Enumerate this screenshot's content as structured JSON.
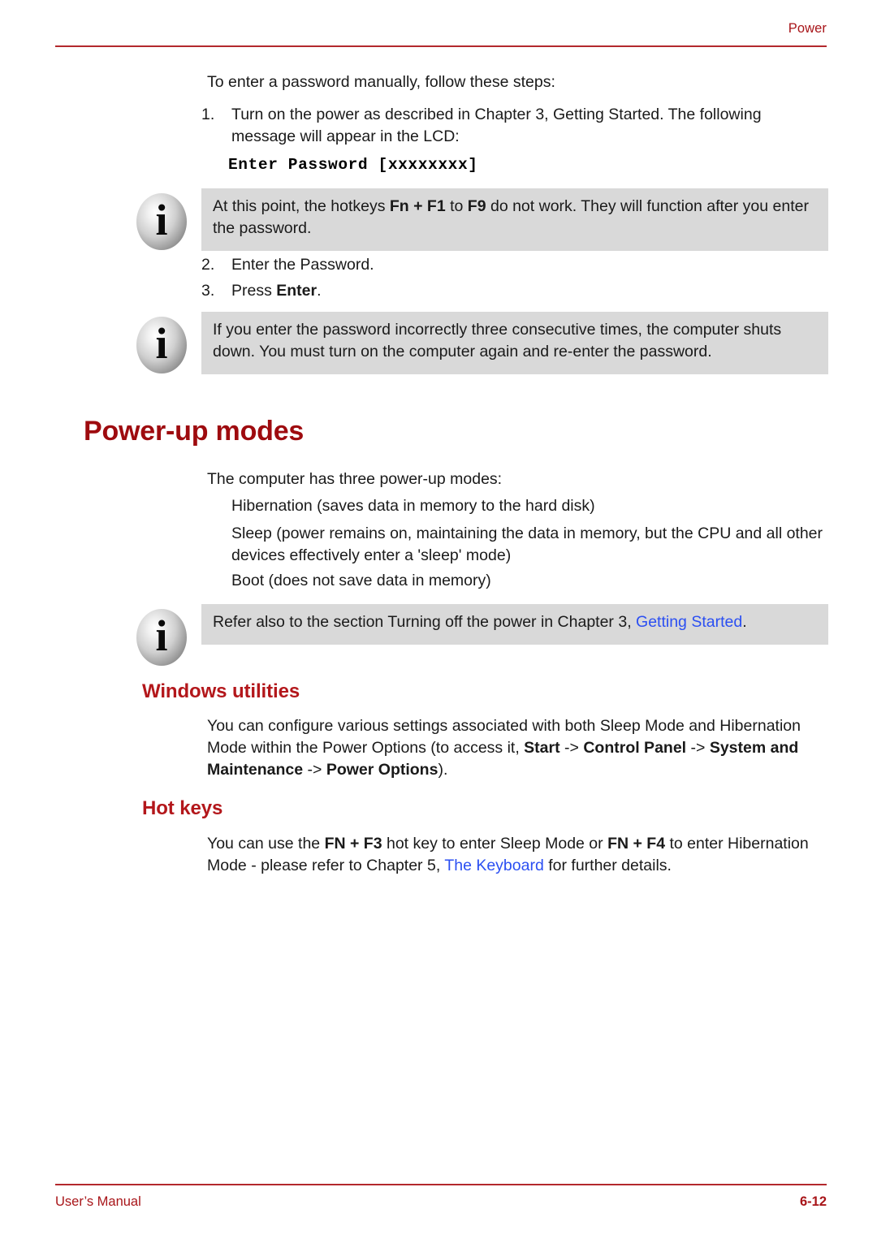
{
  "header": {
    "title": "Power"
  },
  "intro": {
    "text": "To enter a password manually, follow these steps:"
  },
  "steps": [
    {
      "number": "1.",
      "text_before": "Turn on the power as described in Chapter 3, Getting Started. The following message will appear in the LCD:"
    },
    {
      "number": "2.",
      "text": "Enter the Password."
    },
    {
      "number": "3.",
      "text_before": "Press ",
      "bold": "Enter",
      "text_after": "."
    }
  ],
  "lcd_message": "Enter Password [xxxxxxxx]",
  "callouts": [
    {
      "icon": "info-icon",
      "segments": [
        {
          "text": "At this point, the hotkeys "
        },
        {
          "text": "Fn + F1",
          "style": "bold"
        },
        {
          "text": " to "
        },
        {
          "text": "F9",
          "style": "bold"
        },
        {
          "text": " do not work. They will function after you enter the password."
        }
      ]
    },
    {
      "icon": "info-icon",
      "segments": [
        {
          "text": "If you enter the password incorrectly three consecutive times, the computer shuts down. You must turn on the computer again and re-enter the password."
        }
      ]
    },
    {
      "icon": "info-icon",
      "segments": [
        {
          "text": "Refer also to the section Turning off the power in Chapter 3, "
        },
        {
          "text": "Getting Started",
          "style": "link"
        },
        {
          "text": "."
        }
      ]
    }
  ],
  "section_power_up": {
    "heading": "Power-up modes",
    "intro": "The computer has three power-up modes:",
    "modes": [
      "Hibernation (saves data in memory to the hard disk)",
      "Sleep (power remains on, maintaining the data in memory, but the CPU and all other devices effectively enter a 'sleep' mode)",
      "Boot (does not save data in memory)"
    ]
  },
  "section_windows_utilities": {
    "heading": "Windows utilities",
    "segments": [
      {
        "text": "You can configure various settings associated with both Sleep Mode and Hibernation Mode within the Power Options (to access it, "
      },
      {
        "text": "Start",
        "style": "bold"
      },
      {
        "text": " -> "
      },
      {
        "text": "Control Panel",
        "style": "bold"
      },
      {
        "text": " -> "
      },
      {
        "text": "System and Maintenance",
        "style": "bold"
      },
      {
        "text": " -> "
      },
      {
        "text": "Power Options",
        "style": "bold"
      },
      {
        "text": ")."
      }
    ]
  },
  "section_hot_keys": {
    "heading": "Hot keys",
    "segments": [
      {
        "text": "You can use the "
      },
      {
        "text": "FN + F3",
        "style": "bold"
      },
      {
        "text": " hot key to enter Sleep Mode or "
      },
      {
        "text": "FN + F4",
        "style": "bold"
      },
      {
        "text": " to enter Hibernation Mode - please refer to Chapter 5, "
      },
      {
        "text": "The Keyboard",
        "style": "link"
      },
      {
        "text": " for further details."
      }
    ]
  },
  "footer": {
    "left": "User’s Manual",
    "right": "6-12"
  },
  "colors": {
    "heading_red": "#9e0b0f",
    "subheading_red": "#b3171b",
    "rule_red": "#b3282d",
    "header_red": "#a81519",
    "callout_bg": "#d9d9d9",
    "link_blue": "#2b4ff2"
  },
  "icons": {
    "info": "i"
  }
}
